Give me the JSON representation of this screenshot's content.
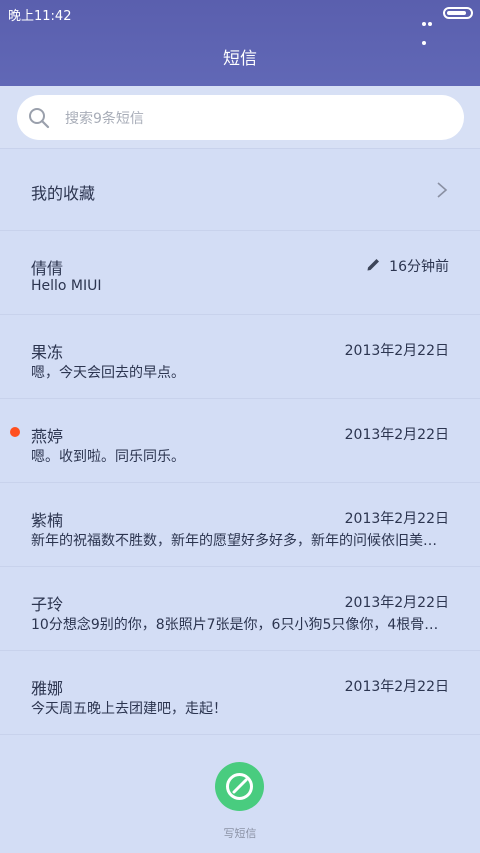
{
  "status_bar": {
    "time": "晚上11:42",
    "battery_level": 0.85
  },
  "header": {
    "title": "短信"
  },
  "search": {
    "placeholder": "搜索9条短信",
    "icon": "search-icon"
  },
  "favorites": {
    "label": "我的收藏",
    "icon": "chevron-right-icon"
  },
  "messages": [
    {
      "name": "倩倩",
      "preview": "Hello MIUI",
      "time": "16分钟前",
      "draft": true,
      "unread": false
    },
    {
      "name": "果冻",
      "preview": "嗯，今天会回去的早点。",
      "time": "2013年2月22日",
      "draft": false,
      "unread": false
    },
    {
      "name": "燕婷",
      "preview": "嗯。收到啦。同乐同乐。",
      "time": "2013年2月22日",
      "draft": false,
      "unread": true
    },
    {
      "name": "紫楠",
      "preview": "新年的祝福数不胜数，新年的愿望好多好多，新年的问候依旧美…",
      "time": "2013年2月22日",
      "draft": false,
      "unread": false
    },
    {
      "name": "子玲",
      "preview": "10分想念9别的你，8张照片7张是你，6只小狗5只像你，4根骨…",
      "time": "2013年2月22日",
      "draft": false,
      "unread": false
    },
    {
      "name": "雅娜",
      "preview": "今天周五晚上去团建吧，走起！",
      "time": "2013年2月22日",
      "draft": false,
      "unread": false
    }
  ],
  "compose": {
    "label": "写短信",
    "icon": "compose-icon"
  },
  "colors": {
    "header": "#5d62b0",
    "background": "#d3ddf5",
    "unread_dot": "#ff4f1f",
    "compose_button": "#49cc7f"
  }
}
